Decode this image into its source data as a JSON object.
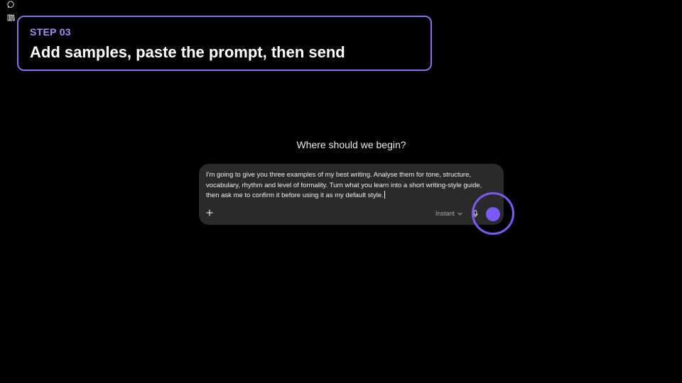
{
  "sidebar": {
    "icons": [
      "new-chat-icon",
      "library-icon"
    ]
  },
  "step_card": {
    "label": "STEP 03",
    "title": "Add samples, paste the prompt, then send",
    "accent_color": "#8b6cf3"
  },
  "main": {
    "greeting": "Where should we begin?"
  },
  "composer": {
    "text": "I'm going to give you three examples of my best writing. Analyse them for tone, structure, vocabulary, rhythm and level of formality. Turn what you learn into a short writing-style guide, then ask me to confirm it before using it as my default style.",
    "model": "Instant",
    "send_color": "#7a5af8"
  }
}
